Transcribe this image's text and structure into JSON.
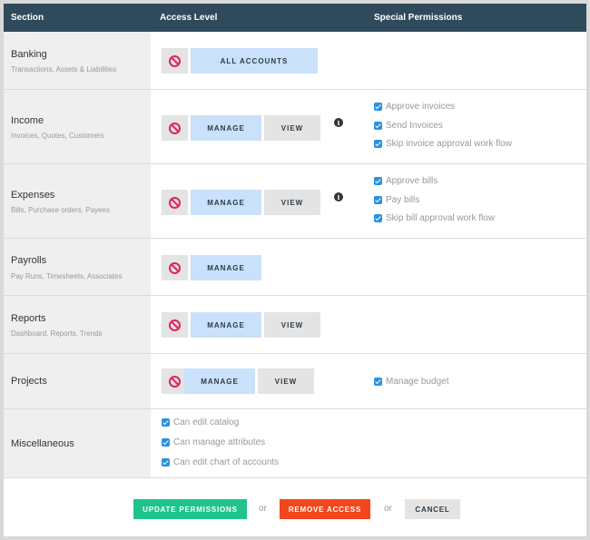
{
  "header": {
    "col_section": "Section",
    "col_access": "Access Level",
    "col_special": "Special Permissions"
  },
  "rows": {
    "banking": {
      "title": "Banking",
      "sub": "Transactions, Assets & Liabilities",
      "all_label": "ALL ACCOUNTS"
    },
    "income": {
      "title": "Income",
      "sub": "Invoices, Quotes, Customers",
      "manage_label": "MANAGE",
      "view_label": "VIEW",
      "perms": [
        "Approve invoices",
        "Send Invoices",
        "Skip invoice approval work flow"
      ]
    },
    "expenses": {
      "title": "Expenses",
      "sub": "Bills, Purchase orders, Payees",
      "manage_label": "MANAGE",
      "view_label": "VIEW",
      "perms": [
        "Approve bills",
        "Pay bills",
        "Skip bill approval work flow"
      ]
    },
    "payrolls": {
      "title": "Payrolls",
      "sub": "Pay Runs, Timesheets, Associates",
      "manage_label": "MANAGE"
    },
    "reports": {
      "title": "Reports",
      "sub": "Dashboard, Reports, Trends",
      "manage_label": "MANAGE",
      "view_label": "VIEW"
    },
    "projects": {
      "title": "Projects",
      "manage_label": "MANAGE",
      "view_label": "VIEW",
      "perms": [
        "Manage budget"
      ]
    },
    "misc": {
      "title": "Miscellaneous",
      "perms": [
        "Can edit catalog",
        "Can manage attributes",
        "Can edit chart of accounts"
      ]
    }
  },
  "info_glyph": "i",
  "footer": {
    "update_label": "UPDATE PERMISSIONS",
    "or1": "or",
    "remove_label": "REMOVE ACCESS",
    "or2": "or",
    "cancel_label": "CANCEL"
  },
  "colors": {
    "header_bg": "#2f4a5a",
    "manage_bg": "#c9e1fb",
    "update_bg": "#1fc48a",
    "remove_bg": "#f2461d",
    "checkbox": "#2a91e0",
    "no_symbol": "#e0245a"
  },
  "icons": {
    "no_access": "no-access-icon",
    "info": "info-icon",
    "checkbox": "checkbox-checked-icon"
  }
}
